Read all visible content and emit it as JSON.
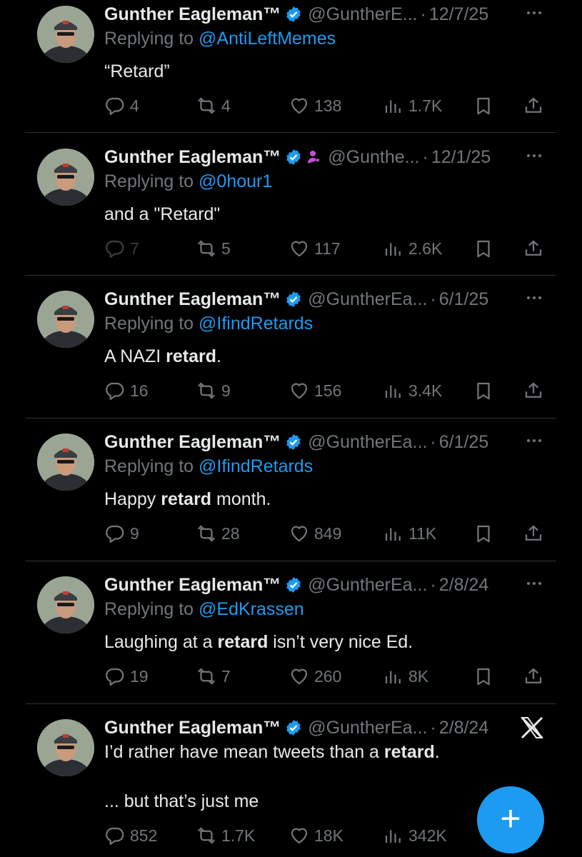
{
  "author": {
    "name": "Gunther Eagleman™"
  },
  "tweets": [
    {
      "handle": "@GuntherE...",
      "date": "12/7/25",
      "reply_prefix": "Replying to",
      "reply_to": "@AntiLeftMemes",
      "text_parts": [
        "“Retard”"
      ],
      "bold_index": [],
      "stats": {
        "replies": "4",
        "reposts": "4",
        "likes": "138",
        "views": "1.7K"
      }
    },
    {
      "handle": "@Gunthe...",
      "date": "12/1/25",
      "reply_prefix": "Replying to",
      "reply_to": "@0hour1",
      "text_parts": [
        "and a \"Retard\""
      ],
      "bold_index": [],
      "stats": {
        "replies": "7",
        "reposts": "5",
        "likes": "117",
        "views": "2.6K"
      }
    },
    {
      "handle": "@GuntherEa...",
      "date": "6/1/25",
      "reply_prefix": "Replying to",
      "reply_to": "@IfindRetards",
      "text_parts": [
        "A NAZI ",
        "retard",
        "."
      ],
      "bold_index": [
        1
      ],
      "stats": {
        "replies": "16",
        "reposts": "9",
        "likes": "156",
        "views": "3.4K"
      }
    },
    {
      "handle": "@GuntherEa...",
      "date": "6/1/25",
      "reply_prefix": "Replying to",
      "reply_to": "@IfindRetards",
      "text_parts": [
        "Happy ",
        "retard",
        " month."
      ],
      "bold_index": [
        1
      ],
      "stats": {
        "replies": "9",
        "reposts": "28",
        "likes": "849",
        "views": "11K"
      }
    },
    {
      "handle": "@GuntherEa...",
      "date": "2/8/24",
      "reply_prefix": "Replying to",
      "reply_to": "@EdKrassen",
      "text_parts": [
        "Laughing at a ",
        "retard",
        " isn’t very nice Ed."
      ],
      "bold_index": [
        1
      ],
      "stats": {
        "replies": "19",
        "reposts": "7",
        "likes": "260",
        "views": "8K"
      }
    },
    {
      "handle": "@GuntherEa...",
      "date": "2/8/24",
      "text_parts": [
        "I’d rather have mean tweets than a ",
        "retard",
        "."
      ],
      "bold_index": [
        1
      ],
      "text2": "... but that’s just me",
      "stats": {
        "replies": "852",
        "reposts": "1.7K",
        "likes": "18K",
        "views": "342K"
      }
    }
  ],
  "fab": {
    "label": "+"
  },
  "icons": {
    "verified": "verified-badge-icon",
    "affiliate": "affiliate-person-icon",
    "more": "more-dots-icon",
    "reply": "reply-icon",
    "repost": "repost-icon",
    "like": "heart-icon",
    "views": "views-icon",
    "bookmark": "bookmark-icon",
    "share": "share-icon",
    "x": "x-logo-icon",
    "compose": "compose-plus-icon"
  },
  "colors": {
    "background": "#000000",
    "text": "#e7e9ea",
    "muted": "#71767b",
    "accent": "#1d9bf0",
    "affiliate": "#c44fd4"
  }
}
